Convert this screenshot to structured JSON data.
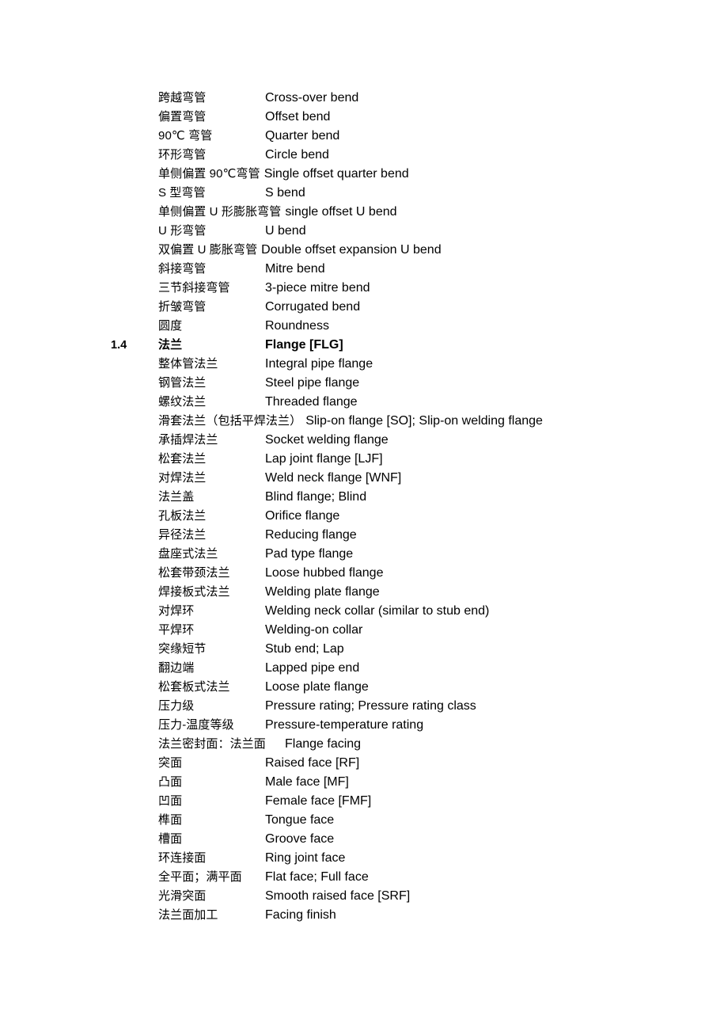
{
  "document": {
    "type": "bilingual-glossary",
    "language_columns": [
      "Chinese",
      "English"
    ],
    "section_number_column_label": "",
    "page_background": "#ffffff",
    "text_color": "#000000"
  },
  "rows": [
    {
      "num": "",
      "cn": "跨越弯管",
      "en": "Cross-over bend",
      "style": "normal"
    },
    {
      "num": "",
      "cn": "偏置弯管",
      "en": "Offset bend",
      "style": "normal"
    },
    {
      "num": "",
      "cn": "90℃ 弯管",
      "en": "Quarter bend",
      "style": "normal"
    },
    {
      "num": "",
      "cn": "环形弯管",
      "en": "Circle bend",
      "style": "normal"
    },
    {
      "num": "",
      "cn": "单侧偏置 90℃弯管",
      "en": "Single offset quarter bend",
      "style": "inline"
    },
    {
      "num": "",
      "cn": "S 型弯管",
      "en": "S bend",
      "style": "normal"
    },
    {
      "num": "",
      "cn": "单侧偏置 U 形膨胀弯管",
      "en": "single offset U bend",
      "style": "inline"
    },
    {
      "num": "",
      "cn": "U 形弯管",
      "en": "U bend",
      "style": "normal"
    },
    {
      "num": "",
      "cn": "双偏置 U 膨胀弯管",
      "en": "Double offset expansion U bend",
      "style": "inline"
    },
    {
      "num": "",
      "cn": "斜接弯管",
      "en": "Mitre bend",
      "style": "normal"
    },
    {
      "num": "",
      "cn": "三节斜接弯管",
      "en": "3-piece mitre bend",
      "style": "normal"
    },
    {
      "num": "",
      "cn": "折皱弯管",
      "en": "Corrugated bend",
      "style": "normal"
    },
    {
      "num": "",
      "cn": "圆度",
      "en": "Roundness",
      "style": "normal"
    },
    {
      "num": "1.4",
      "cn": "法兰",
      "en": "Flange [FLG]",
      "style": "bold"
    },
    {
      "num": "",
      "cn": "整体管法兰",
      "en": "Integral pipe flange",
      "style": "normal"
    },
    {
      "num": "",
      "cn": "钢管法兰",
      "en": "Steel pipe flange",
      "style": "normal"
    },
    {
      "num": "",
      "cn": "螺纹法兰",
      "en": "Threaded flange",
      "style": "normal"
    },
    {
      "num": "",
      "cn": "滑套法兰（包括平焊法兰）",
      "en": "Slip-on flange [SO]; Slip-on welding flange",
      "style": "inline"
    },
    {
      "num": "",
      "cn": "承插焊法兰",
      "en": "Socket welding flange",
      "style": "normal"
    },
    {
      "num": "",
      "cn": "松套法兰",
      "en": "Lap joint flange [LJF]",
      "style": "normal"
    },
    {
      "num": "",
      "cn": "对焊法兰",
      "en": "Weld neck flange [WNF]",
      "style": "normal"
    },
    {
      "num": "",
      "cn": "法兰盖",
      "en": "Blind flange; Blind",
      "style": "normal"
    },
    {
      "num": "",
      "cn": "孔板法兰",
      "en": "Orifice flange",
      "style": "normal"
    },
    {
      "num": "",
      "cn": "异径法兰",
      "en": "Reducing flange",
      "style": "normal"
    },
    {
      "num": "",
      "cn": "盘座式法兰",
      "en": "Pad type flange",
      "style": "normal"
    },
    {
      "num": "",
      "cn": "松套带颈法兰",
      "en": "Loose hubbed flange",
      "style": "normal"
    },
    {
      "num": "",
      "cn": "焊接板式法兰",
      "en": "Welding plate flange",
      "style": "normal"
    },
    {
      "num": "",
      "cn": "对焊环",
      "en": "Welding neck collar (similar to stub end)",
      "style": "normal"
    },
    {
      "num": "",
      "cn": "平焊环",
      "en": "Welding-on collar",
      "style": "normal"
    },
    {
      "num": "",
      "cn": "突缘短节",
      "en": "Stub end; Lap",
      "style": "normal"
    },
    {
      "num": "",
      "cn": "翻边端",
      "en": "Lapped pipe end",
      "style": "normal"
    },
    {
      "num": "",
      "cn": "松套板式法兰",
      "en": "Loose plate flange",
      "style": "normal"
    },
    {
      "num": "",
      "cn": "压力级",
      "en": "Pressure rating; Pressure rating class",
      "style": "normal"
    },
    {
      "num": "",
      "cn": "压力-温度等级",
      "en": "Pressure-temperature rating",
      "style": "normal"
    },
    {
      "num": "",
      "cn": "法兰密封面：法兰面",
      "en": "Flange facing",
      "style": "wide-cn"
    },
    {
      "num": "",
      "cn": "突面",
      "en": "Raised face [RF]",
      "style": "normal"
    },
    {
      "num": "",
      "cn": "凸面",
      "en": "Male face [MF]",
      "style": "normal"
    },
    {
      "num": "",
      "cn": "凹面",
      "en": "Female face [FMF]",
      "style": "normal"
    },
    {
      "num": "",
      "cn": "榫面",
      "en": "Tongue face",
      "style": "normal"
    },
    {
      "num": "",
      "cn": "槽面",
      "en": "Groove face",
      "style": "normal"
    },
    {
      "num": "",
      "cn": "环连接面",
      "en": "Ring joint face",
      "style": "normal"
    },
    {
      "num": "",
      "cn": "全平面；满平面",
      "en": "Flat face; Full face",
      "style": "normal"
    },
    {
      "num": "",
      "cn": "光滑突面",
      "en": "Smooth raised face [SRF]",
      "style": "normal"
    },
    {
      "num": "",
      "cn": "法兰面加工",
      "en": "Facing finish",
      "style": "normal"
    }
  ]
}
